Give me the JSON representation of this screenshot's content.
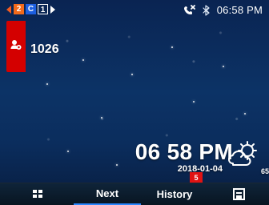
{
  "statusbar": {
    "badge_one": "2",
    "badge_two": "C",
    "badge_three": "1",
    "time": "06:58 PM"
  },
  "account": {
    "label": "1026"
  },
  "clock": {
    "time": "06 58 PM",
    "date": "2018-01-04",
    "temperature": "65"
  },
  "notification": {
    "count": "5"
  },
  "softkeys": {
    "next": "Next",
    "history": "History"
  },
  "colors": {
    "account_tab": "#d40000",
    "status_orange": "#f26a1b",
    "status_blue": "#1d5fe0",
    "notification_red": "#e01313",
    "active_underline": "#2a88ff"
  },
  "icons": {
    "account_icon": "user-icon",
    "phone_missed_icon": "phone-missed-icon",
    "bluetooth_icon": "bluetooth-icon",
    "weather_icon": "partly-cloudy-icon",
    "grid_icon": "grid-icon",
    "menu_icon": "menu-icon"
  }
}
